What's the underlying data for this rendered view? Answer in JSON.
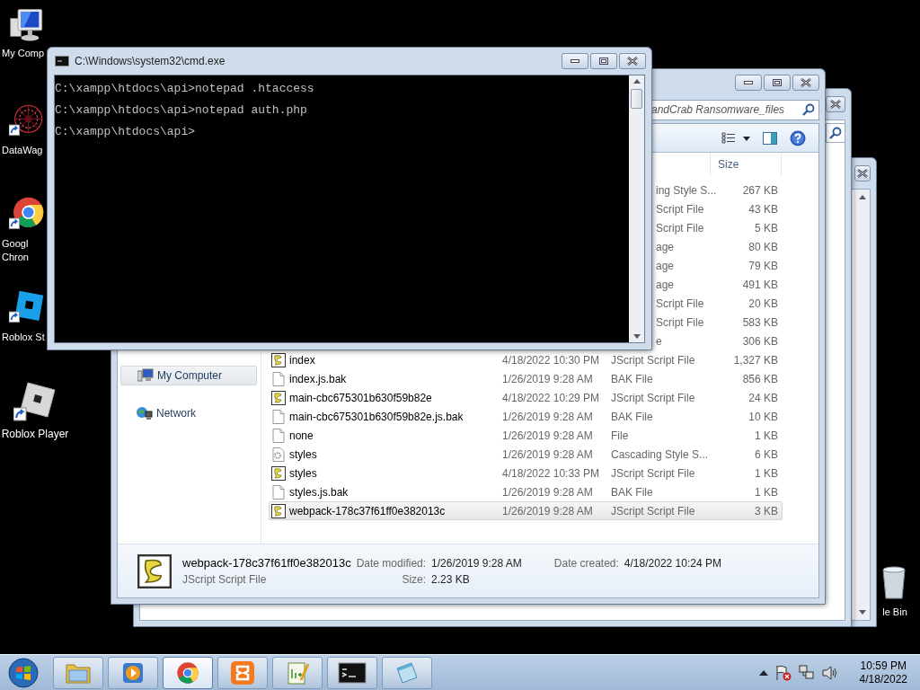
{
  "desktop_icons": [
    {
      "kind": "computer",
      "label": "My Comp"
    },
    {
      "kind": "spiral",
      "label": "DataWag"
    },
    {
      "kind": "chrome",
      "label": "Googl\nChron"
    },
    {
      "kind": "studio",
      "label": "Roblox St"
    },
    {
      "kind": "player",
      "label": "Roblox Player"
    }
  ],
  "recycle_bin": {
    "label": "le Bin"
  },
  "cmd": {
    "title": "C:\\Windows\\system32\\cmd.exe",
    "lines": [
      "C:\\xampp\\htdocs\\api>notepad .htaccess",
      "C:\\xampp\\htdocs\\api>notepad auth.php",
      "C:\\xampp\\htdocs\\api>"
    ]
  },
  "explorer": {
    "search": {
      "placeholder": "andCrab Ransomware_files"
    },
    "columns": [
      "Size"
    ],
    "nav": [
      {
        "label": "My Computer",
        "kind": "computer",
        "selected": true
      },
      {
        "label": "Network",
        "kind": "network",
        "selected": false
      }
    ],
    "rows": [
      {
        "kind": "partial",
        "type": "ing Style S...",
        "size": "267 KB",
        "selected": false
      },
      {
        "kind": "partial",
        "type": "Script File",
        "size": "43 KB",
        "selected": false
      },
      {
        "kind": "partial",
        "type": "Script File",
        "size": "5 KB",
        "selected": false
      },
      {
        "kind": "partial",
        "type": "age",
        "size": "80 KB",
        "selected": false
      },
      {
        "kind": "partial",
        "type": "age",
        "size": "79 KB",
        "selected": false
      },
      {
        "kind": "partial",
        "type": "age",
        "size": "491 KB",
        "selected": false
      },
      {
        "kind": "partial",
        "type": "Script File",
        "size": "20 KB",
        "selected": false
      },
      {
        "kind": "partial",
        "type": "Script File",
        "size": "583 KB",
        "selected": false
      },
      {
        "kind": "partial",
        "type": "e",
        "size": "306 KB",
        "selected": false
      },
      {
        "kind": "script",
        "name": "index",
        "date": "4/18/2022 10:30 PM",
        "type": "JScript Script File",
        "size": "1,327 KB",
        "selected": false
      },
      {
        "kind": "blank",
        "name": "index.js.bak",
        "date": "1/26/2019 9:28 AM",
        "type": "BAK File",
        "size": "856 KB",
        "selected": false
      },
      {
        "kind": "script",
        "name": "main-cbc675301b630f59b82e",
        "date": "4/18/2022 10:29 PM",
        "type": "JScript Script File",
        "size": "24 KB",
        "selected": false
      },
      {
        "kind": "blank",
        "name": "main-cbc675301b630f59b82e.js.bak",
        "date": "1/26/2019 9:28 AM",
        "type": "BAK File",
        "size": "10 KB",
        "selected": false
      },
      {
        "kind": "blank",
        "name": "none",
        "date": "1/26/2019 9:28 AM",
        "type": "File",
        "size": "1 KB",
        "selected": false
      },
      {
        "kind": "css",
        "name": "styles",
        "date": "1/26/2019 9:28 AM",
        "type": "Cascading Style S...",
        "size": "6 KB",
        "selected": false
      },
      {
        "kind": "script",
        "name": "styles",
        "date": "4/18/2022 10:33 PM",
        "type": "JScript Script File",
        "size": "1 KB",
        "selected": false
      },
      {
        "kind": "blank",
        "name": "styles.js.bak",
        "date": "1/26/2019 9:28 AM",
        "type": "BAK File",
        "size": "1 KB",
        "selected": false
      },
      {
        "kind": "script",
        "name": "webpack-178c37f61ff0e382013c",
        "date": "1/26/2019 9:28 AM",
        "type": "JScript Script File",
        "size": "3 KB",
        "selected": true
      }
    ],
    "details": {
      "name": "webpack-178c37f61ff0e382013c",
      "type": "JScript Script File",
      "fields": [
        {
          "label": "Date modified:",
          "value": "1/26/2019 9:28 AM"
        },
        {
          "label": "Size:",
          "value": "2.23 KB"
        },
        {
          "label": "Date created:",
          "value": "4/18/2022 10:24 PM"
        }
      ]
    }
  },
  "taskbar": {
    "buttons": [
      {
        "kind": "explorer",
        "active": false
      },
      {
        "kind": "media",
        "active": false
      },
      {
        "kind": "chrome",
        "active": true
      },
      {
        "kind": "xampp",
        "active": false
      },
      {
        "kind": "notepadpp",
        "active": false
      },
      {
        "kind": "cmd",
        "active": false
      },
      {
        "kind": "notepad",
        "active": false
      }
    ],
    "clock": {
      "time": "10:59 PM",
      "date": "4/18/2022"
    }
  }
}
